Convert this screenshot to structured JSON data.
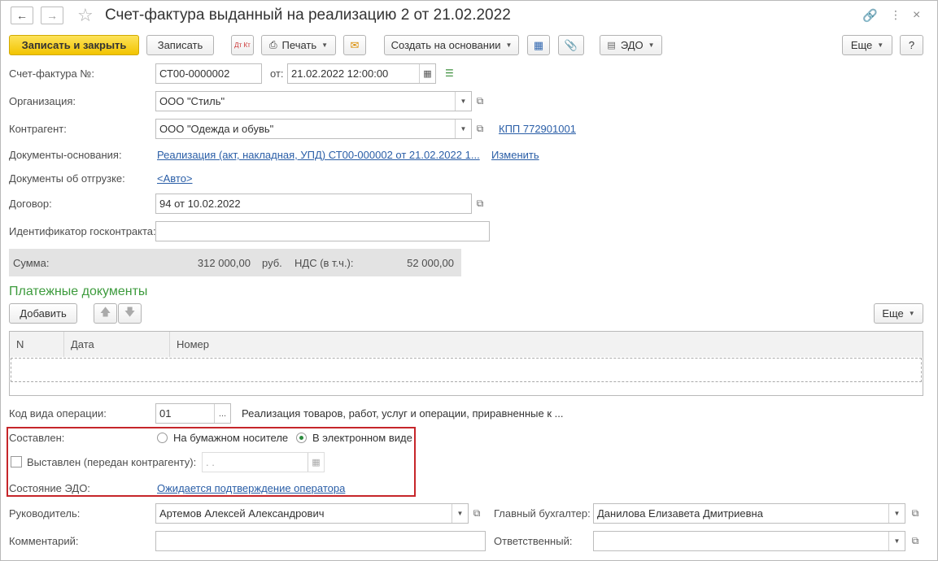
{
  "title": "Счет-фактура выданный на реализацию 2 от 21.02.2022",
  "toolbar": {
    "save_close": "Записать и закрыть",
    "save": "Записать",
    "dtkt": "Дт Кт",
    "print": "Печать",
    "create_based": "Создать на основании",
    "edo": "ЭДО",
    "more": "Еще",
    "help": "?"
  },
  "form": {
    "invoice_no_label": "Счет-фактура №:",
    "invoice_no": "СТ00-0000002",
    "date_label": "от:",
    "date": "21.02.2022 12:00:00",
    "org_label": "Организация:",
    "org": "ООО \"Стиль\"",
    "counterparty_label": "Контрагент:",
    "counterparty": "ООО \"Одежда и обувь\"",
    "kpp": "КПП 772901001",
    "basis_label": "Документы-основания:",
    "basis": "Реализация (акт, накладная, УПД) СТ00-000002 от 21.02.2022 1...",
    "basis_change": "Изменить",
    "shipment_label": "Документы об отгрузке:",
    "shipment": "<Авто>",
    "contract_label": "Договор:",
    "contract": "94 от 10.02.2022",
    "gov_id_label": "Идентификатор госконтракта:",
    "gov_id": "",
    "sum_label": "Сумма:",
    "sum": "312 000,00",
    "currency": "руб.",
    "vat_label": "НДС (в т.ч.):",
    "vat": "52 000,00"
  },
  "payments": {
    "title": "Платежные документы",
    "add": "Добавить",
    "more": "Еще",
    "columns": [
      "N",
      "Дата",
      "Номер"
    ]
  },
  "operation": {
    "code_label": "Код вида операции:",
    "code": "01",
    "code_btn": "...",
    "description": "Реализация товаров, работ, услуг и операции, приравненные к ..."
  },
  "issued": {
    "composed_label": "Составлен:",
    "paper": "На бумажном носителе",
    "electronic": "В электронном виде",
    "selected": "electronic",
    "exposed_label": "Выставлен (передан контрагенту):",
    "exposed_date": " .  .",
    "edo_state_label": "Состояние ЭДО:",
    "edo_state": "Ожидается подтверждение оператора"
  },
  "footer": {
    "head_label": "Руководитель:",
    "head": "Артемов Алексей Александрович",
    "accountant_label": "Главный бухгалтер:",
    "accountant": "Данилова Елизавета Дмитриевна",
    "comment_label": "Комментарий:",
    "comment": "",
    "responsible_label": "Ответственный:",
    "responsible": ""
  }
}
